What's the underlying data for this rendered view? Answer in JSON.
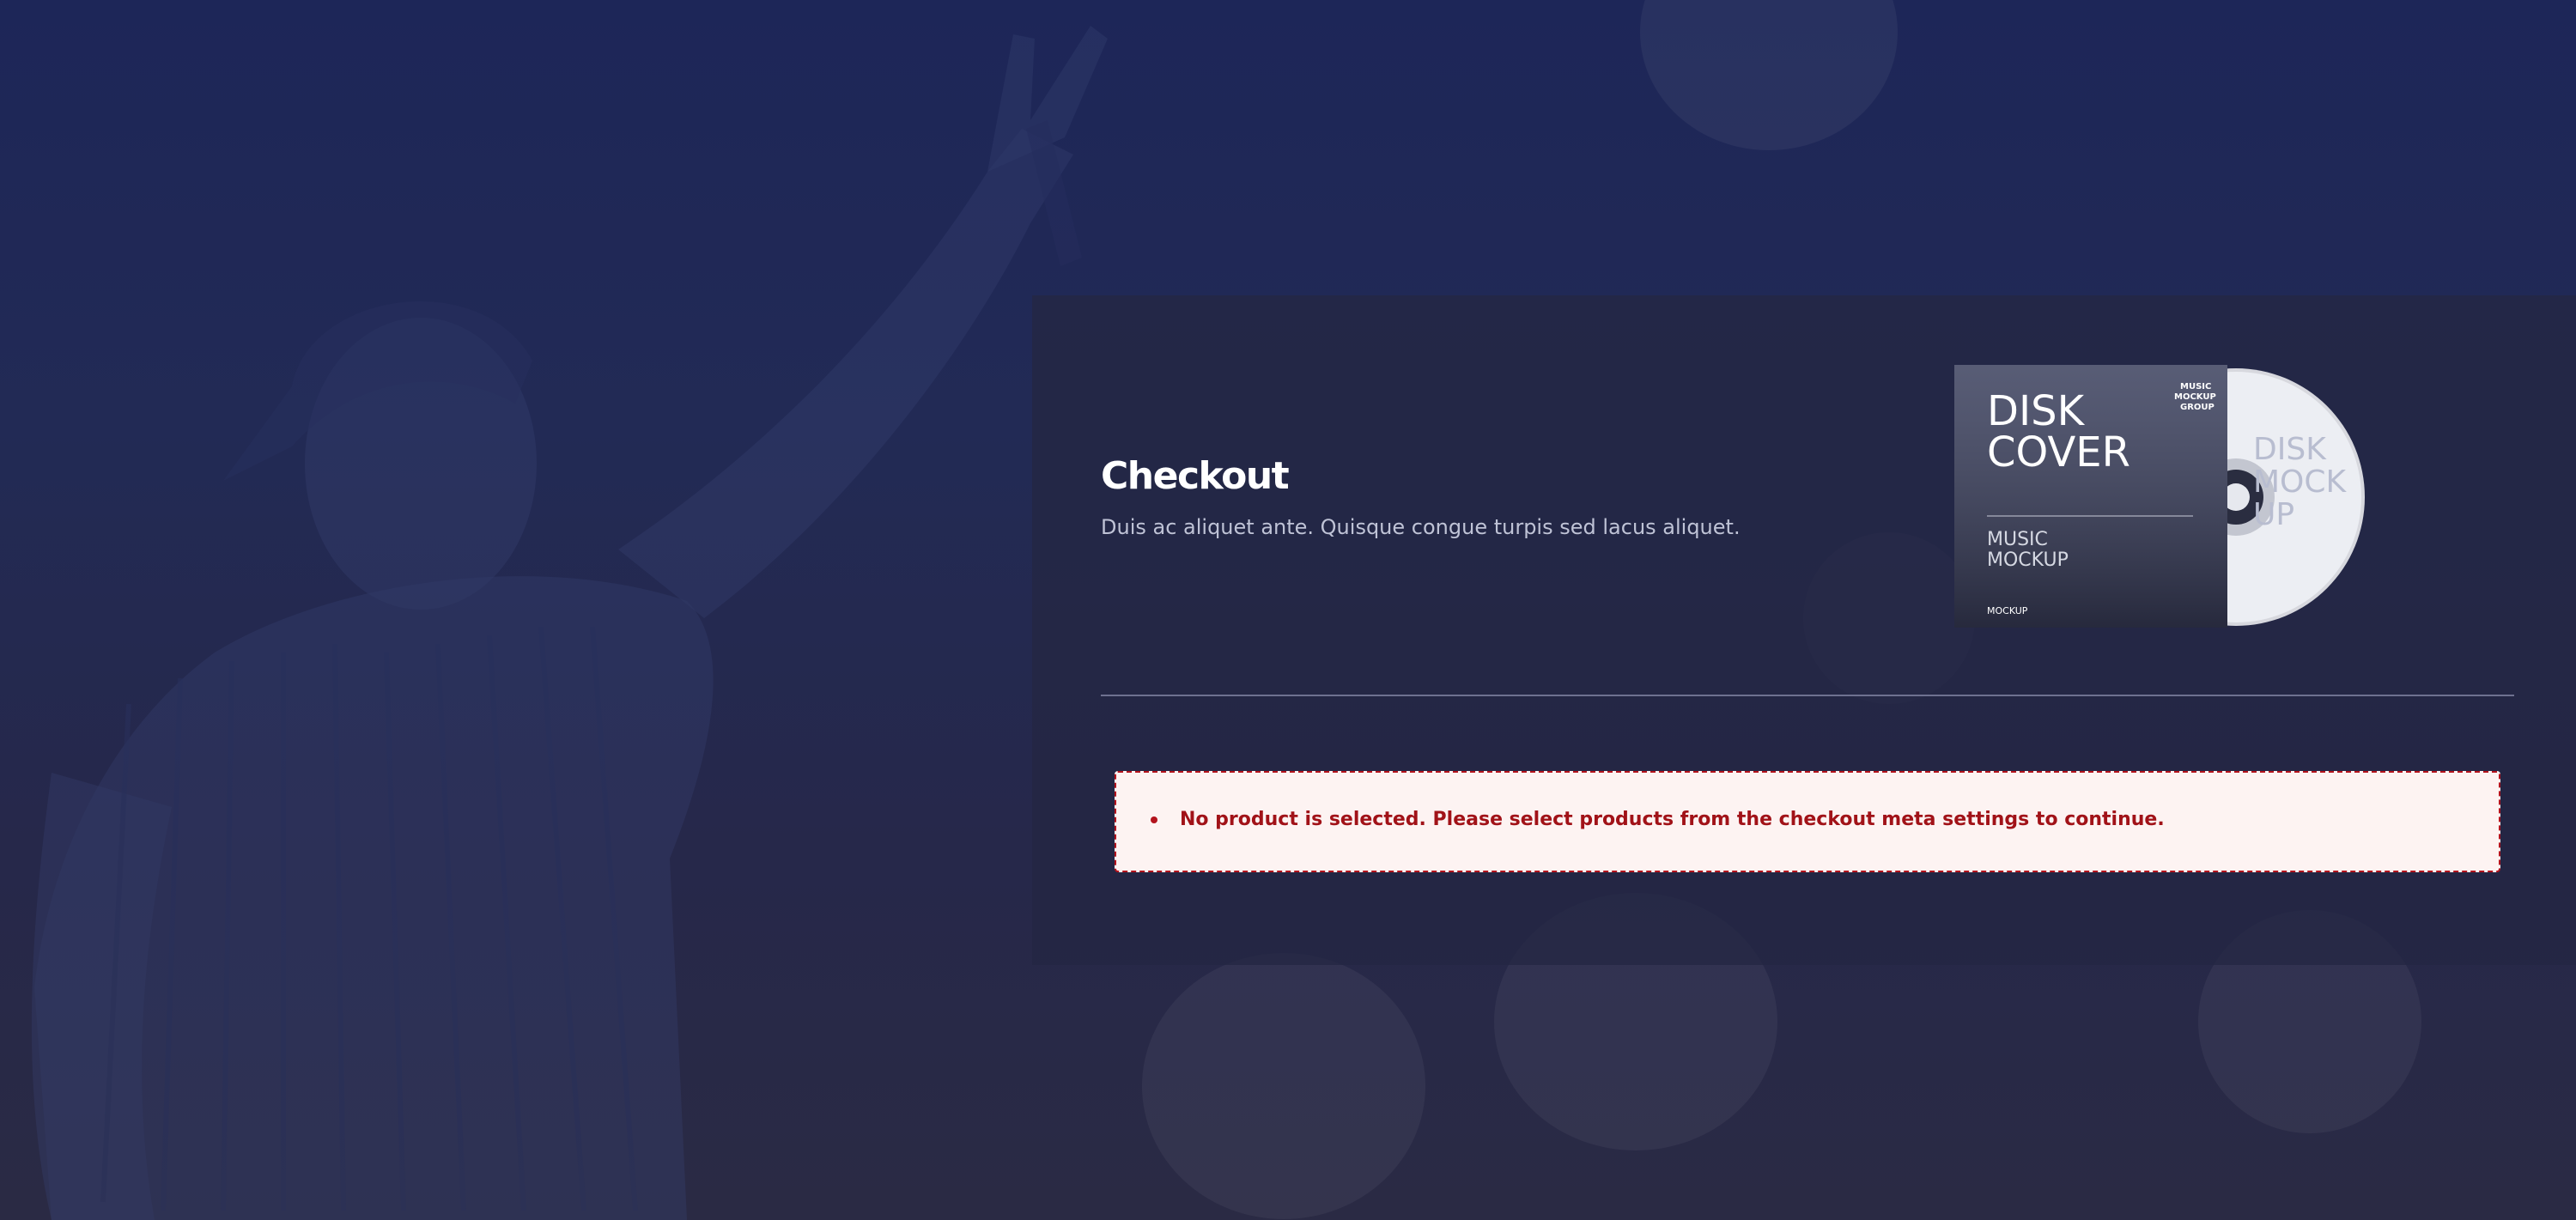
{
  "checkout": {
    "title": "Checkout",
    "description": "Duis ac aliquet ante. Quisque congue turpis sed lacus aliquet."
  },
  "product_image": {
    "cover_title_line1": "DISK",
    "cover_title_line2": "COVER",
    "cover_subtitle_line1": "MUSIC",
    "cover_subtitle_line2": "MOCKUP",
    "cover_corner_line1": "MUSIC",
    "cover_corner_line2": "MOCKUP",
    "cover_corner_line3": "GROUP",
    "cover_footer": "MOCKUP",
    "disc_text_line1": "DISK",
    "disc_text_line2": "MOCK",
    "disc_text_line3": "UP"
  },
  "notices": {
    "errors": [
      "No product is selected. Please select products from the checkout meta settings to continue."
    ]
  },
  "colors": {
    "background": "#1d2658",
    "panel": "#242642",
    "error_border": "#b3131d",
    "error_text": "#a11218",
    "error_background": "#fdf3f2"
  }
}
